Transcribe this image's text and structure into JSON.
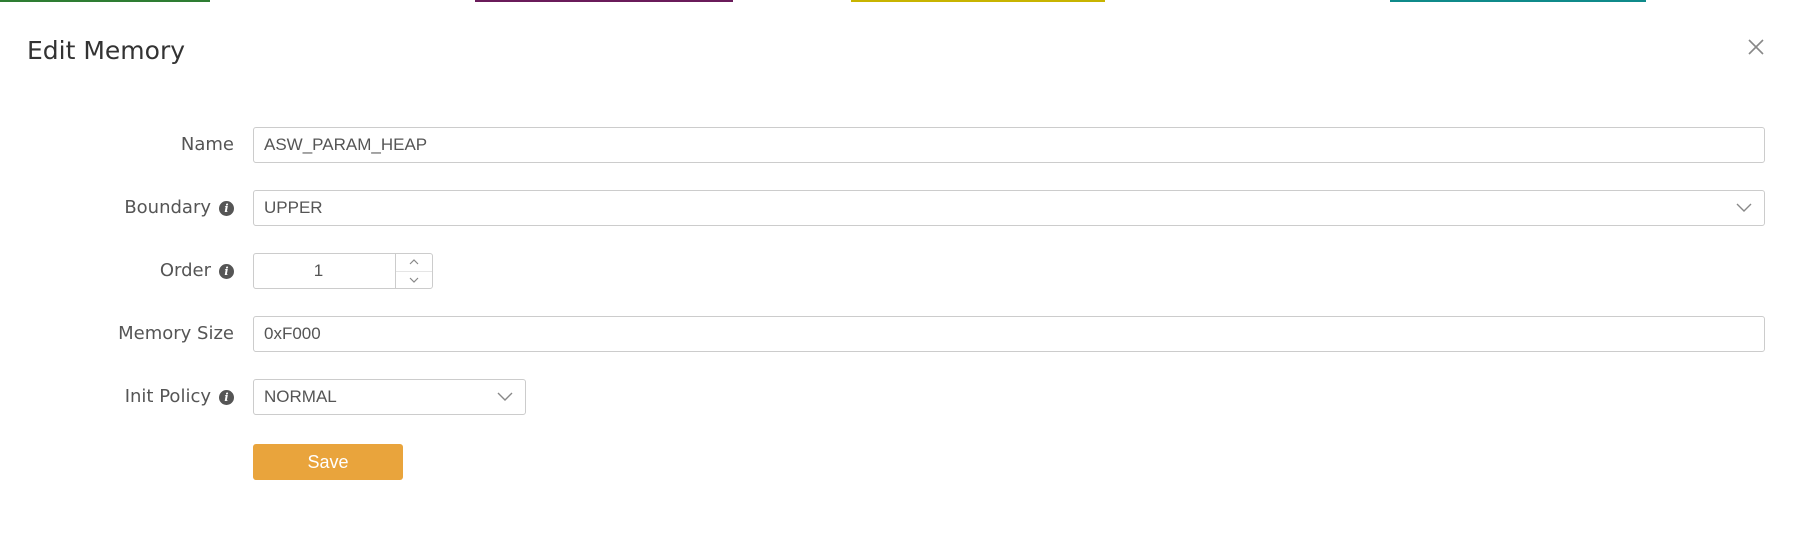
{
  "dialog": {
    "title": "Edit Memory"
  },
  "form": {
    "name": {
      "label": "Name",
      "value": "ASW_PARAM_HEAP"
    },
    "boundary": {
      "label": "Boundary",
      "value": "UPPER"
    },
    "order": {
      "label": "Order",
      "value": "1"
    },
    "memory_size": {
      "label": "Memory Size",
      "value": "0xF000"
    },
    "init_policy": {
      "label": "Init Policy",
      "value": "NORMAL"
    }
  },
  "actions": {
    "save_label": "Save"
  },
  "icons": {
    "info": "info-icon",
    "close": "close-icon",
    "chevron": "chevron-down-icon",
    "spin_up": "chevron-up-icon",
    "spin_down": "chevron-down-icon"
  },
  "colors": {
    "accent": "#e9a43c",
    "border": "#cccccc",
    "text": "#555555",
    "top_strip": [
      "#2e7d32",
      "#ffffff",
      "#6a1b5a",
      "#ffffff",
      "#c8b400",
      "#ffffff",
      "#0f8a8a",
      "#ffffff"
    ]
  }
}
